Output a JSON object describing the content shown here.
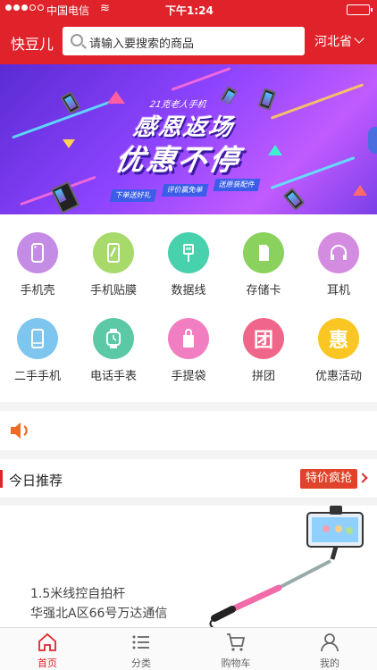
{
  "status_bar": {
    "carrier": "中国电信",
    "time": "下午1:24"
  },
  "header": {
    "logo": "快豆儿",
    "search_placeholder": "请输入要搜索的商品",
    "region": "河北省"
  },
  "banner": {
    "subtitle": "21克老人手机",
    "line1": "感恩返场",
    "line2": "优惠不停",
    "pills": [
      "下单送好礼",
      "评价赢免单",
      "送原装配件"
    ]
  },
  "categories": [
    {
      "label": "手机壳",
      "icon": "phone-case-icon",
      "color": "#c58ce6"
    },
    {
      "label": "手机贴膜",
      "icon": "screen-film-icon",
      "color": "#a8d96b"
    },
    {
      "label": "数据线",
      "icon": "usb-cable-icon",
      "color": "#47d1ad"
    },
    {
      "label": "存储卡",
      "icon": "memory-card-icon",
      "color": "#8bd15e"
    },
    {
      "label": "耳机",
      "icon": "headphones-icon",
      "color": "#d48ce0"
    },
    {
      "label": "二手手机",
      "icon": "used-phone-icon",
      "color": "#7ec6f0"
    },
    {
      "label": "电话手表",
      "icon": "smart-watch-icon",
      "color": "#5bc9a5"
    },
    {
      "label": "手提袋",
      "icon": "handbag-icon",
      "color": "#f27ec2"
    },
    {
      "label": "拼团",
      "icon": "group-buy-icon",
      "glyph": "团",
      "color": "#f0668a"
    },
    {
      "label": "优惠活动",
      "icon": "promotion-icon",
      "glyph": "惠",
      "color": "#f9c623"
    }
  ],
  "recommend": {
    "title": "今日推荐",
    "badge": "特价疯抢"
  },
  "product": {
    "name": "1.5米线控自拍杆",
    "shop": "华强北A区66号万达通信"
  },
  "tabs": [
    {
      "label": "首页",
      "icon": "home-icon",
      "active": true
    },
    {
      "label": "分类",
      "icon": "list-icon",
      "active": false
    },
    {
      "label": "购物车",
      "icon": "cart-icon",
      "active": false
    },
    {
      "label": "我的",
      "icon": "user-icon",
      "active": false
    }
  ],
  "colors": {
    "brand_red": "#e0232b"
  }
}
